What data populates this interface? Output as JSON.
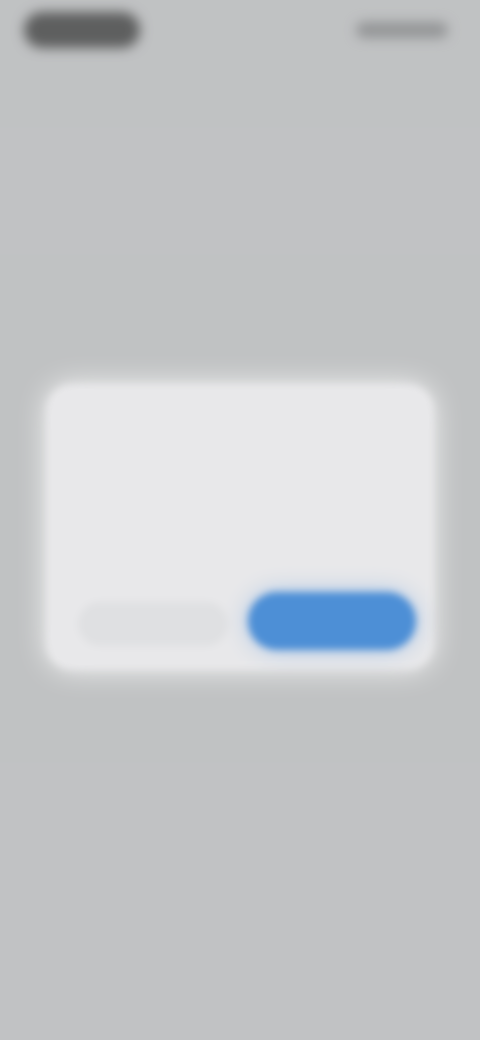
{
  "status_bar": {
    "time": "",
    "indicators": ""
  },
  "dialog": {
    "title": "",
    "message": "",
    "cancel_label": "",
    "confirm_label": ""
  },
  "colors": {
    "background": "#c2c3c5",
    "dialog_background": "#e8e8ea",
    "primary_button": "#4d8fd6",
    "secondary_button": "#dfe0e2"
  },
  "icons": {
    "status_time_pill": "dark-pill",
    "status_indicators": "signal-battery-icons"
  }
}
